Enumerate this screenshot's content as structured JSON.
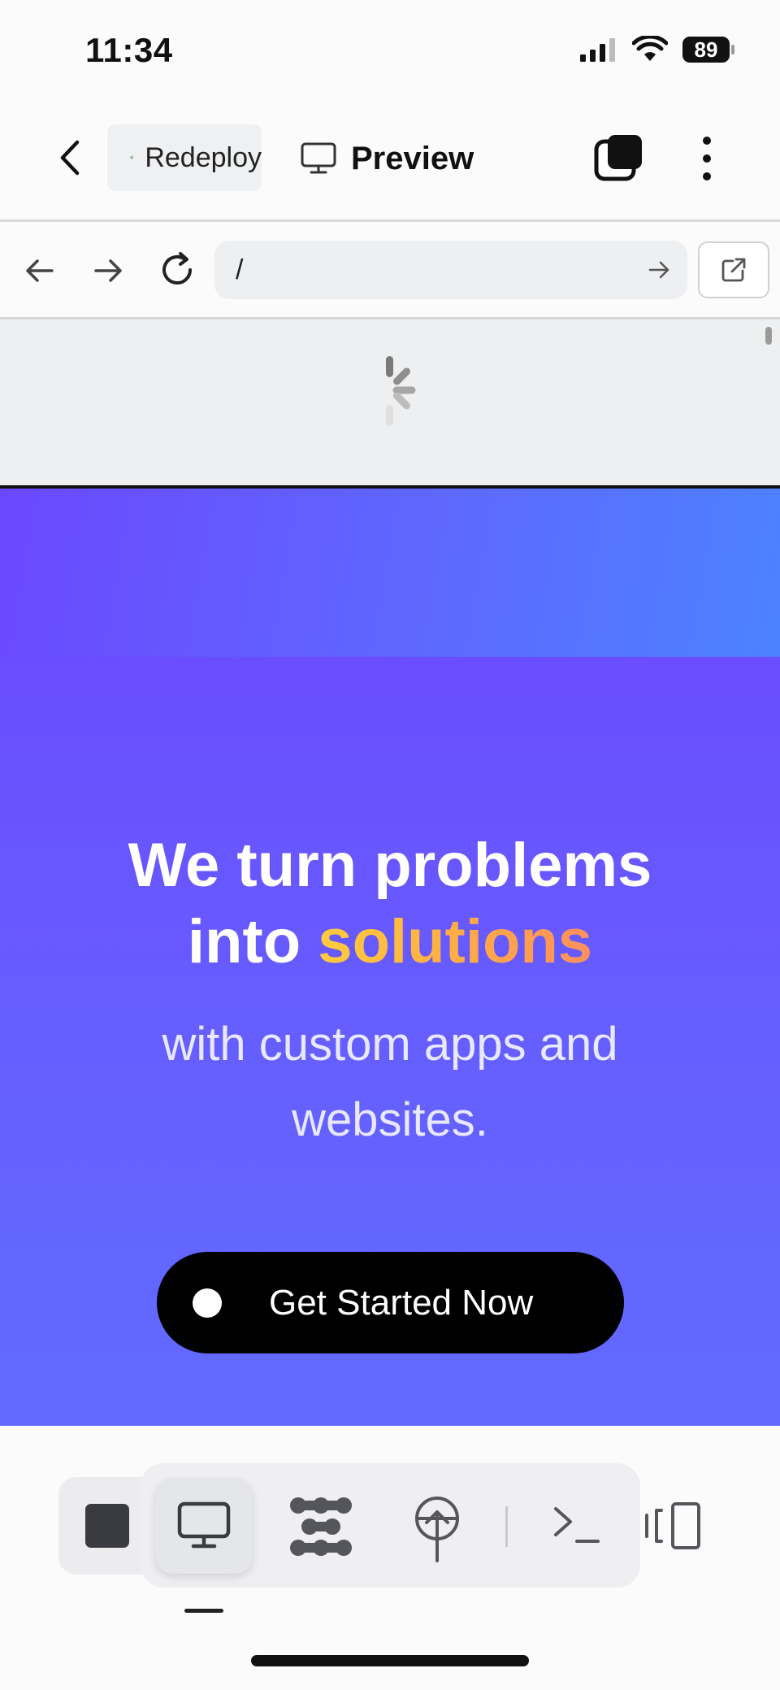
{
  "status_bar": {
    "time": "11:34",
    "battery": "89"
  },
  "app_bar": {
    "deploy_tab_label": "Redeploy",
    "preview_tab_label": "Preview"
  },
  "browser": {
    "url": "/"
  },
  "hero": {
    "title_line1": "We turn problems",
    "title_into": "into ",
    "title_accent": "solutions",
    "subtitle": "with custom apps and websites.",
    "cta_label": "Get Started Now"
  },
  "colors": {
    "hero_primary": "#6650ff",
    "accent_gradient": [
      "#ffcc3d",
      "#ff8f5c"
    ],
    "cta_background": "#000000"
  },
  "icons": {
    "deploy": "deploy-icon",
    "preview": "monitor-icon",
    "agent": "agent-icon",
    "shell": "terminal-icon",
    "devices": "devices-icon"
  }
}
